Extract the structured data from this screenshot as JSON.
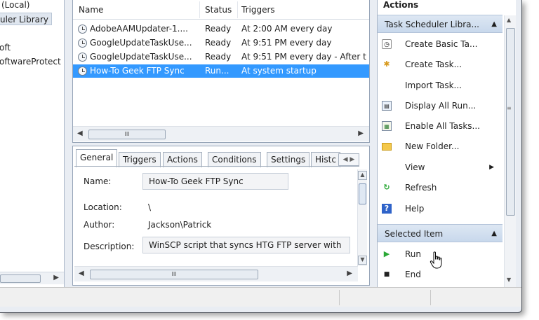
{
  "tree": {
    "items": [
      "(Local)",
      "uler Library",
      "oft",
      "oftwareProtect"
    ]
  },
  "task_list": {
    "columns": [
      "Name",
      "Status",
      "Triggers"
    ],
    "rows": [
      {
        "name": "AdobeAAMUpdater-1....",
        "status": "Ready",
        "trigger": "At 2:00 AM every day"
      },
      {
        "name": "GoogleUpdateTaskUse...",
        "status": "Ready",
        "trigger": "At 9:51 PM every day"
      },
      {
        "name": "GoogleUpdateTaskUse...",
        "status": "Ready",
        "trigger": "At 9:51 PM every day - After t"
      },
      {
        "name": "How-To Geek FTP Sync",
        "status": "Run...",
        "trigger": "At system startup"
      }
    ],
    "scroll_thumb": "III"
  },
  "details": {
    "tabs": [
      "General",
      "Triggers",
      "Actions",
      "Conditions",
      "Settings",
      "Histc"
    ],
    "tab_scroll": "◀ ▶",
    "name_label": "Name:",
    "name_value": "How-To Geek FTP Sync",
    "location_label": "Location:",
    "location_value": "\\",
    "author_label": "Author:",
    "author_value": "Jackson\\Patrick",
    "description_label": "Description:",
    "description_value": "WinSCP script that syncs HTG FTP server with",
    "scroll_thumb": "III"
  },
  "actions": {
    "title": "Actions",
    "group_library": "Task Scheduler Libra...",
    "library_items": [
      {
        "label": "Create Basic Ta...",
        "icon": "wizard-icon"
      },
      {
        "label": "Create Task...",
        "icon": "create-task-icon"
      },
      {
        "label": "Import Task...",
        "icon": ""
      },
      {
        "label": "Display All Run...",
        "icon": "display-running-icon"
      },
      {
        "label": "Enable All Tasks...",
        "icon": "enable-history-icon"
      },
      {
        "label": "New Folder...",
        "icon": "folder-icon"
      },
      {
        "label": "View",
        "icon": ""
      },
      {
        "label": "Refresh",
        "icon": "refresh-icon"
      },
      {
        "label": "Help",
        "icon": "help-icon"
      }
    ],
    "group_selected": "Selected Item",
    "selected_items": [
      {
        "label": "Run",
        "icon": "run-icon"
      },
      {
        "label": "End",
        "icon": "end-icon"
      }
    ]
  },
  "colors": {
    "selection": "#3399ff",
    "group_header": "#c8d8ec",
    "run_green": "#2aa836",
    "help_blue": "#2f63c9"
  }
}
